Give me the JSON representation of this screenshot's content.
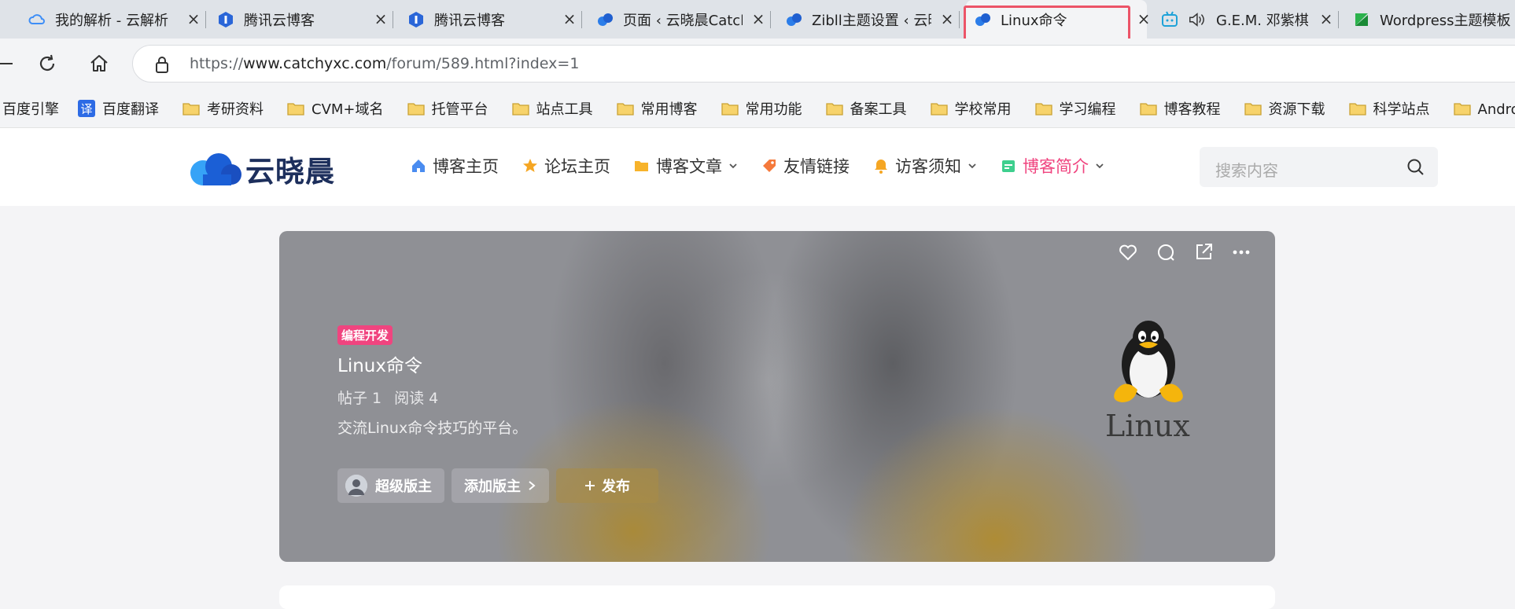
{
  "tabs": [
    {
      "title": "我的解析 - 云解析",
      "icon": "cloud-dns-icon"
    },
    {
      "title": "腾讯云博客",
      "icon": "tencent-cloud-icon"
    },
    {
      "title": "腾讯云博客",
      "icon": "tencent-cloud-icon"
    },
    {
      "title": "页面 ‹ 云晓晨Catchyxc",
      "icon": "site-logo-icon"
    },
    {
      "title": "Zibll主题设置 ‹ 云晓晨",
      "icon": "site-logo-icon"
    },
    {
      "title": "Linux命令",
      "icon": "site-logo-icon",
      "active": true
    },
    {
      "title": "G.E.M. 邓紫棋",
      "icon": "bilibili-icon",
      "audio": true
    },
    {
      "title": "Wordpress主题模板",
      "icon": "green-icon"
    }
  ],
  "address": {
    "scheme": "https://",
    "host": "www.catchyxc.com",
    "path": "/forum/589.html?index=1"
  },
  "bookmarks": [
    {
      "label": "百度引擎",
      "icon": "none"
    },
    {
      "label": "百度翻译",
      "icon": "translate-icon"
    },
    {
      "label": "考研资料",
      "icon": "folder-icon"
    },
    {
      "label": "CVM+域名",
      "icon": "folder-icon"
    },
    {
      "label": "托管平台",
      "icon": "folder-icon"
    },
    {
      "label": "站点工具",
      "icon": "folder-icon"
    },
    {
      "label": "常用博客",
      "icon": "folder-icon"
    },
    {
      "label": "常用功能",
      "icon": "folder-icon"
    },
    {
      "label": "备案工具",
      "icon": "folder-icon"
    },
    {
      "label": "学校常用",
      "icon": "folder-icon"
    },
    {
      "label": "学习编程",
      "icon": "folder-icon"
    },
    {
      "label": "博客教程",
      "icon": "folder-icon"
    },
    {
      "label": "资源下载",
      "icon": "folder-icon"
    },
    {
      "label": "科学站点",
      "icon": "folder-icon"
    },
    {
      "label": "Android开发",
      "icon": "folder-icon"
    }
  ],
  "site": {
    "logo_text": "云晓晨",
    "nav": [
      {
        "label": "博客主页",
        "icon": "home-icon",
        "dropdown": false
      },
      {
        "label": "论坛主页",
        "icon": "star-icon",
        "dropdown": false
      },
      {
        "label": "博客文章",
        "icon": "folder-open-icon",
        "dropdown": true
      },
      {
        "label": "友情链接",
        "icon": "tag-icon",
        "dropdown": false
      },
      {
        "label": "访客须知",
        "icon": "bell-icon",
        "dropdown": true
      },
      {
        "label": "博客简介",
        "icon": "calendar-icon",
        "dropdown": true,
        "active": true
      }
    ],
    "search_placeholder": "搜索内容"
  },
  "hero": {
    "badge": "编程开发",
    "title": "Linux命令",
    "stats": [
      "帖子 1",
      "阅读 4"
    ],
    "description": "交流Linux命令技巧的平台。",
    "buttons": {
      "moderator": "超级版主",
      "add_moderator": "添加版主",
      "publish": "发布"
    },
    "image_label": "Linux"
  },
  "colors": {
    "accent_pink": "#f0447f",
    "highlight_red": "#ec5468",
    "logo_blue": "#2b7de9"
  }
}
